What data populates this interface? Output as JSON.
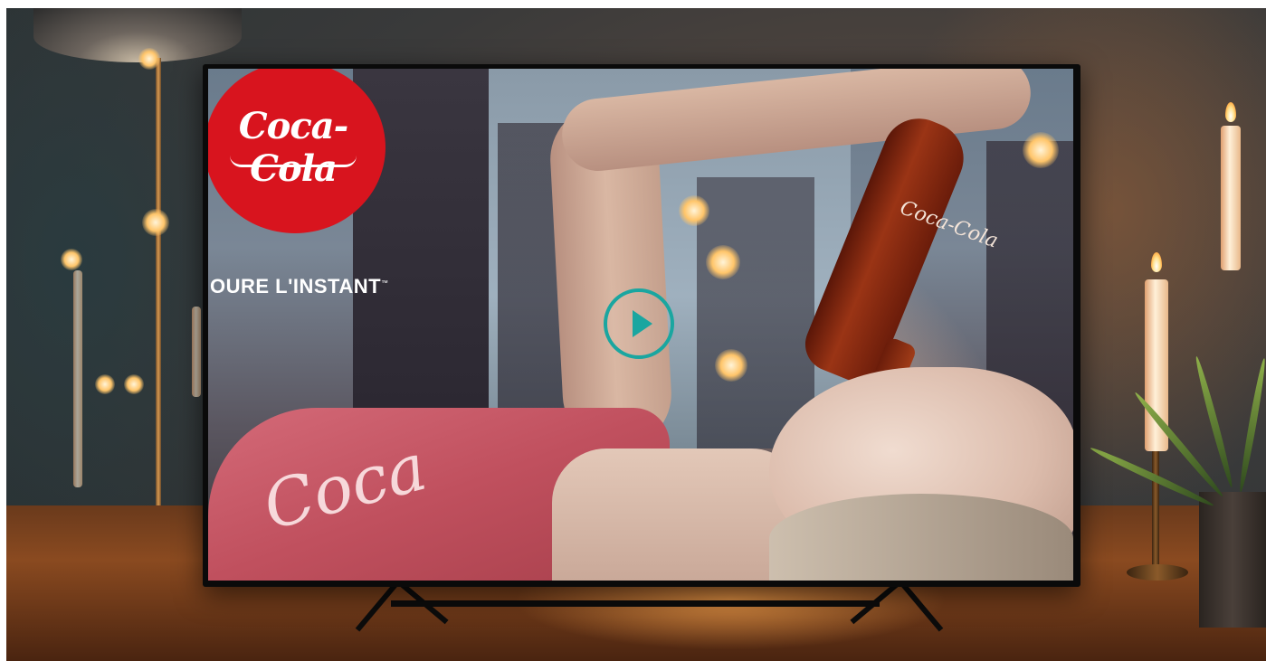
{
  "video": {
    "brand_logo_text": "Coca-Cola",
    "tagline": "OURE L'INSTANT",
    "tagline_mark": "™",
    "bottle_text": "Coca-Cola",
    "shirt_text": "Coca"
  },
  "player": {
    "play_icon": "play-icon",
    "accent_color": "#1aa6a0"
  },
  "colors": {
    "brand_red": "#d8141e",
    "tv_frame": "#0a0a0a"
  }
}
